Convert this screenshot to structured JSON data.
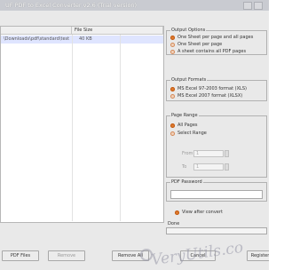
{
  "window": {
    "title": "UF PDF to Excel Converter v2.6 (Trial version)"
  },
  "file_list": {
    "columns": [
      "",
      "File Size"
    ],
    "rows": [
      {
        "name": "\\Downloads\\pdf\\standard\\test...",
        "size": "40 KB"
      }
    ]
  },
  "output_options": {
    "legend": "Output Options",
    "options": [
      {
        "label": "One Sheet per page and all pages",
        "selected": true
      },
      {
        "label": "One Sheet per page",
        "selected": false
      },
      {
        "label": "A sheet contains all PDF pages",
        "selected": false
      }
    ]
  },
  "output_formats": {
    "legend": "Output Formats",
    "options": [
      {
        "label": "MS Excel 97-2003 format (XLS)",
        "selected": true
      },
      {
        "label": "MS Excel 2007 format (XLSX)",
        "selected": false
      }
    ]
  },
  "page_range": {
    "legend": "Page Range",
    "options": [
      {
        "label": "All Pages",
        "selected": true
      },
      {
        "label": "Select Range",
        "selected": false
      }
    ],
    "from_label": "From",
    "to_label": "To",
    "from_value": "1",
    "to_value": "1"
  },
  "pdf_password": {
    "legend": "PDF Password",
    "value": ""
  },
  "options_misc": {
    "view_after_convert": "View after convert",
    "done_label": "Done"
  },
  "buttons": {
    "add": "PDF Files",
    "remove": "Remove",
    "remove_all": "Remove All",
    "cancel": "Cancel",
    "register": "Register"
  },
  "watermark": "VeryUtils.co"
}
